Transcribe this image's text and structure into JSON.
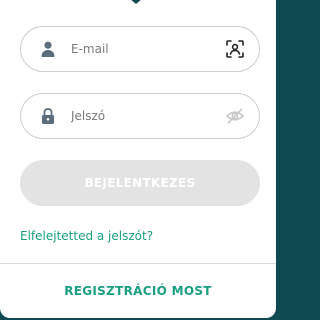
{
  "login_form": {
    "email": {
      "value": "",
      "placeholder": "E-mail",
      "lead_icon": "user-icon",
      "trail_icon": "face-scan-icon"
    },
    "password": {
      "value": "",
      "placeholder": "Jelszó",
      "lead_icon": "lock-icon",
      "trail_icon": "eye-off-icon"
    },
    "login_label": "BEJELENTKEZES",
    "forgot_label": "Elfelejtetted a jelszót?",
    "register_label": "REGISZTRÁCIÓ MOST"
  },
  "colors": {
    "background": "#0f4a52",
    "card": "#ffffff",
    "accent": "#1a9e82",
    "disabled_button": "#e3e3e3",
    "field_border": "#cfcfcf",
    "icon": "#5b6c7c"
  }
}
